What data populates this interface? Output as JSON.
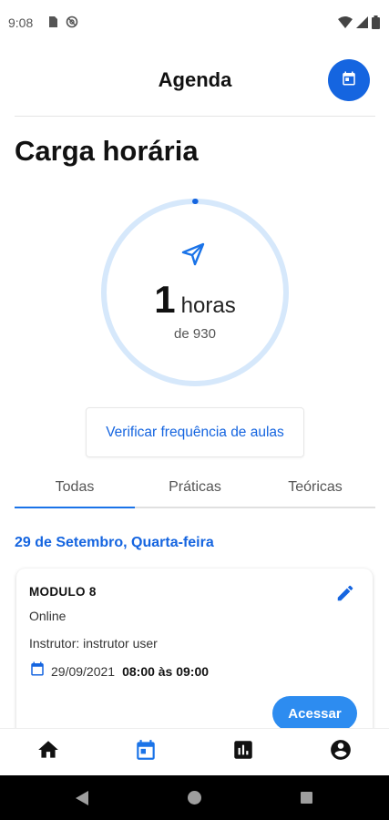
{
  "status_bar": {
    "time": "9:08",
    "left_icons": [
      "sim-card-icon",
      "at-sign-icon"
    ],
    "right_icons": [
      "wifi-icon",
      "signal-icon",
      "battery-icon"
    ]
  },
  "header": {
    "title": "Agenda",
    "action_icon": "calendar-icon"
  },
  "section": {
    "title": "Carga horária"
  },
  "workload": {
    "icon": "send-icon",
    "value": "1",
    "unit": "horas",
    "total_text": "de 930",
    "completed": 1,
    "total": 930
  },
  "frequency_button": {
    "label": "Verificar frequência de aulas"
  },
  "tabs": [
    {
      "label": "Todas",
      "active": true
    },
    {
      "label": "Práticas",
      "active": false
    },
    {
      "label": "Teóricas",
      "active": false
    }
  ],
  "schedule": {
    "date_header": "29 de Setembro, Quarta-feira",
    "classes": [
      {
        "module": "MODULO 8",
        "mode": "Online",
        "instructor": "Instrutor: instrutor user",
        "date": "29/09/2021",
        "time": "08:00 às 09:00",
        "action_label": "Acessar"
      }
    ]
  },
  "bottom_nav": [
    {
      "icon": "home-icon",
      "active": false
    },
    {
      "icon": "calendar-icon",
      "active": true
    },
    {
      "icon": "bar-chart-icon",
      "active": false
    },
    {
      "icon": "account-icon",
      "active": false
    }
  ],
  "colors": {
    "primary": "#1565e0",
    "accent_button": "#2d8cf0",
    "ring_track": "#d6e8fb",
    "nav_active": "#1a73e8",
    "nav_inactive": "#111111"
  }
}
